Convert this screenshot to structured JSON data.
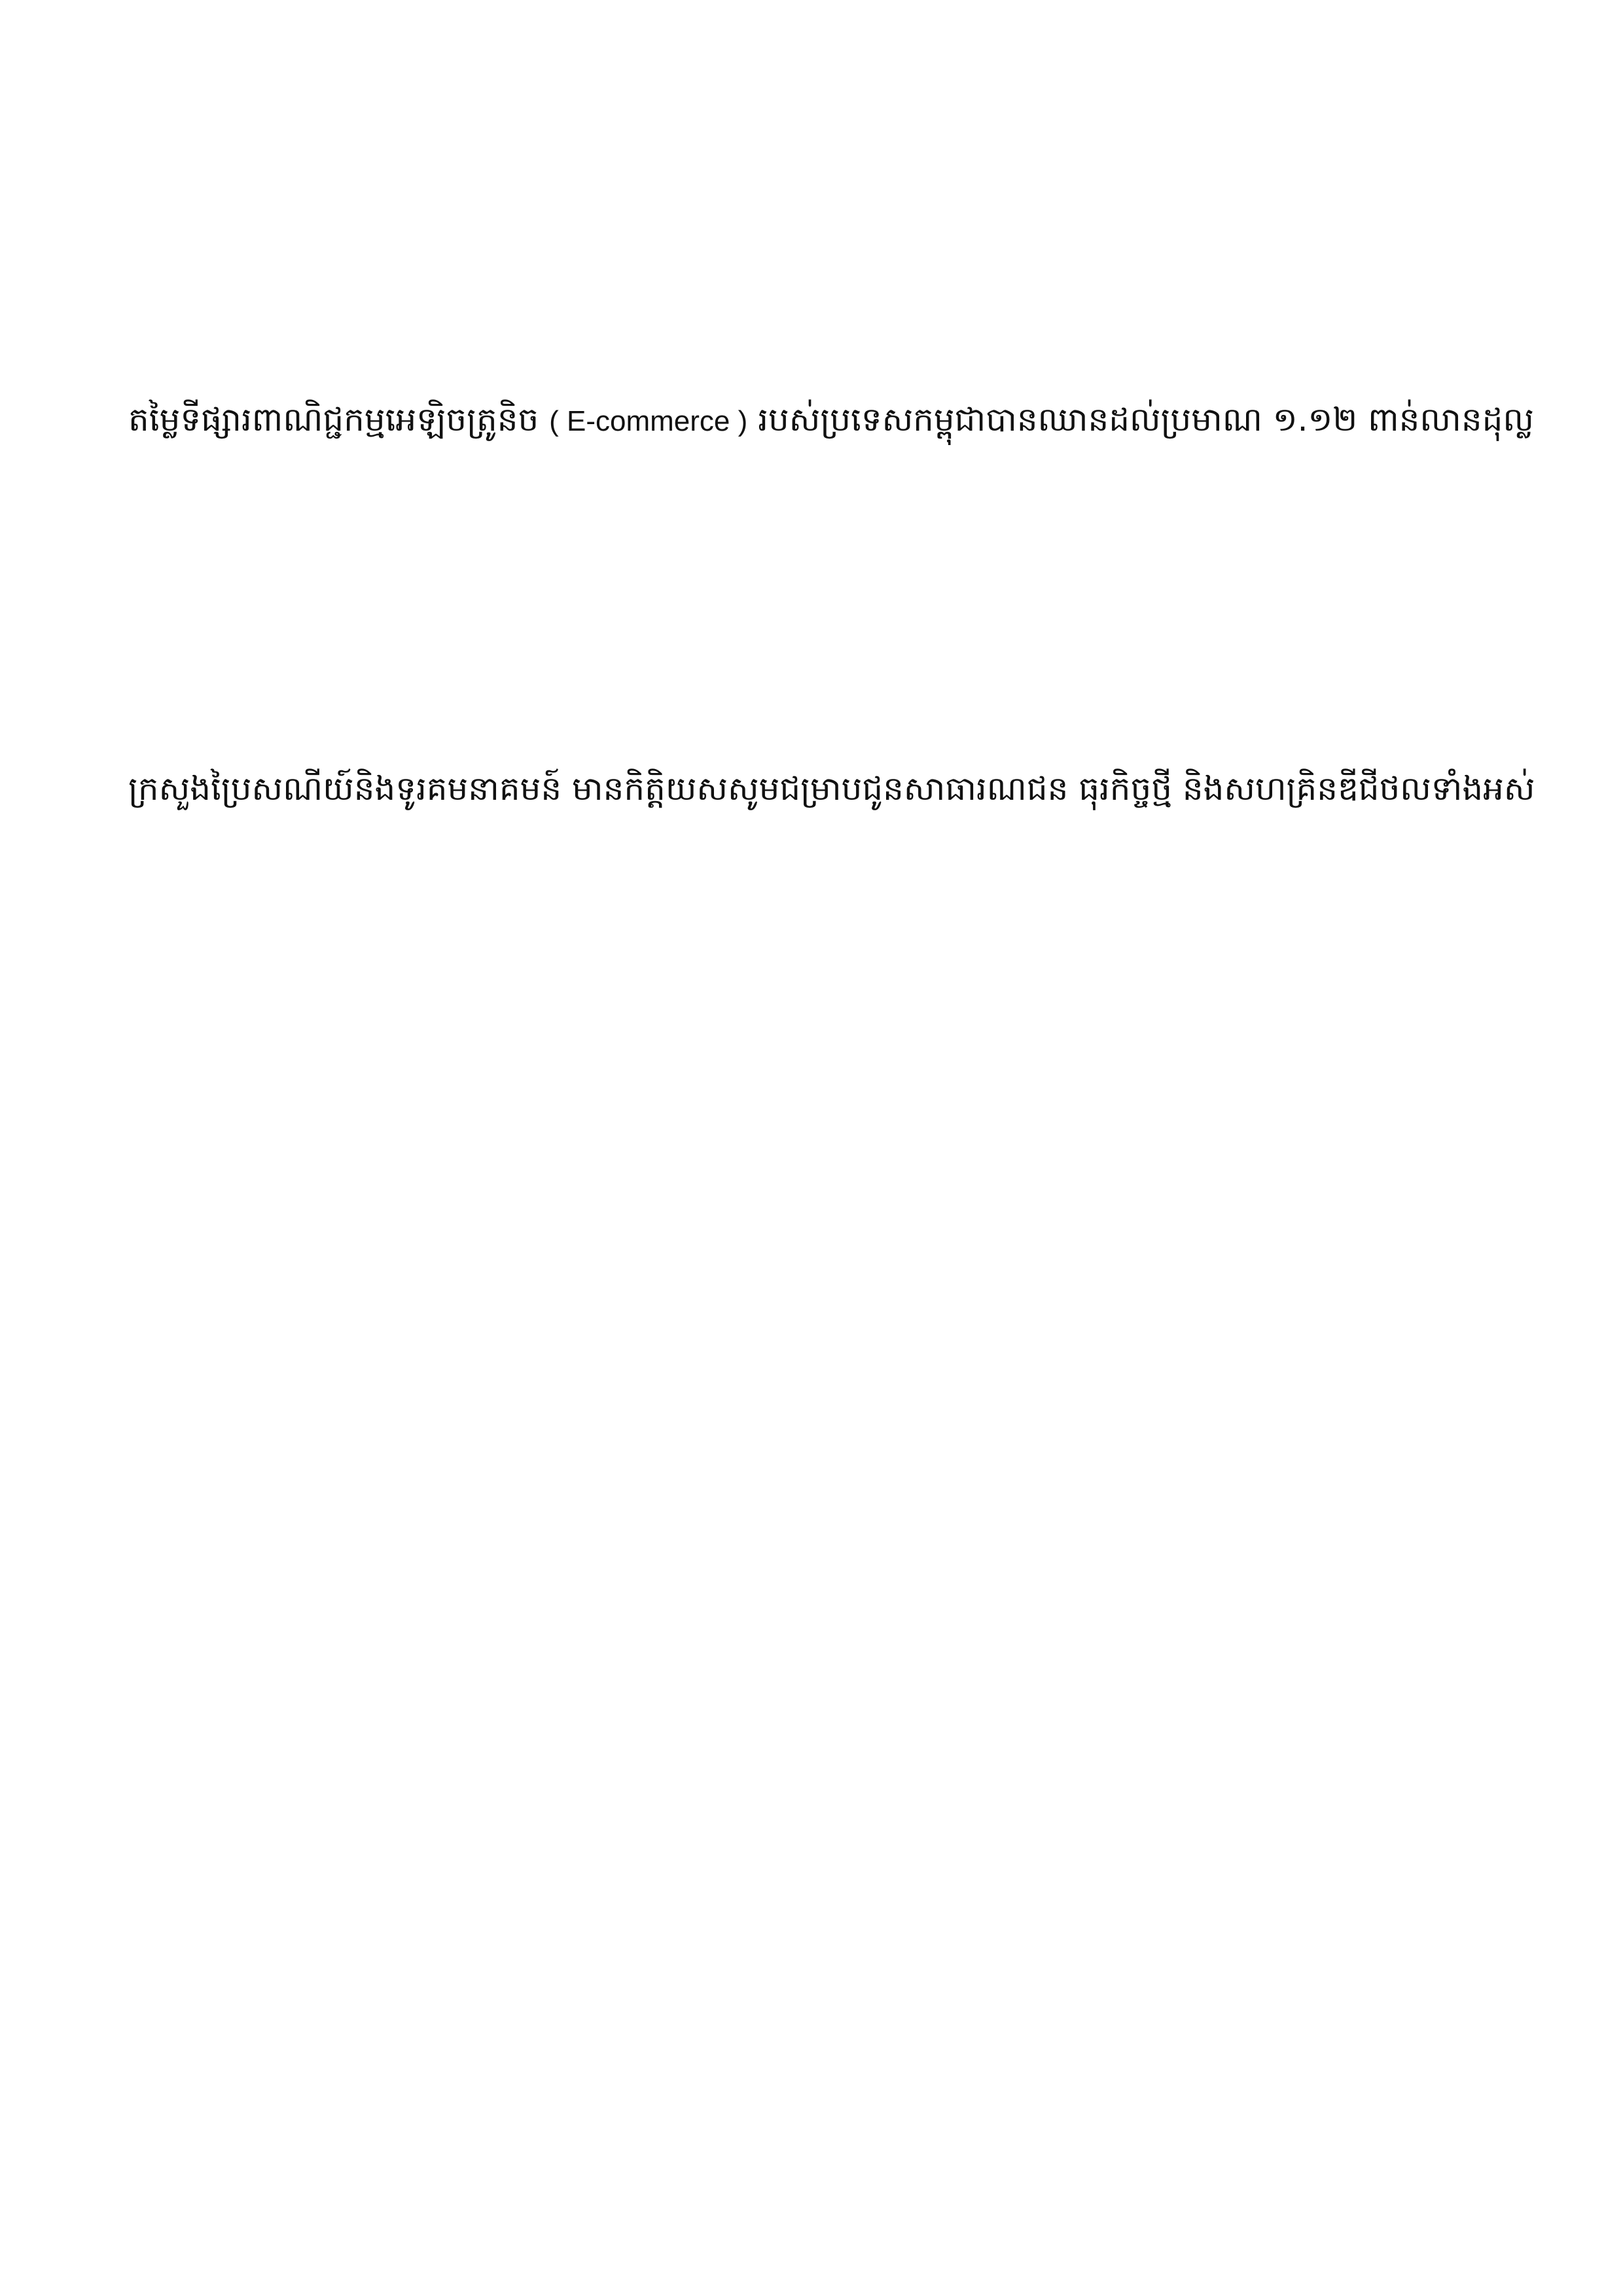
{
  "document": {
    "paragraphs": [
      {
        "before": "តម្លៃទីផ្សារពាណិជ្ជកម្មអេឡិចត្រូនិច ",
        "latin": "( E-commerce )",
        "after": " របស់ប្រទេសកម្ពុជាបានឈានដល់ប្រមាណ ១.១២ ពាន់លានដុល្ល"
      },
      {
        "text": "ក្រសួងប្រៃសណីយ៍និងទូរគមនាគមន៍ មានកិត្តិយសសូមជម្រាបជូនសាធារណជន ធុរកិច្ចថ្មី និងសហគ្រិនឌីជីថលទាំងអស់"
      }
    ]
  }
}
